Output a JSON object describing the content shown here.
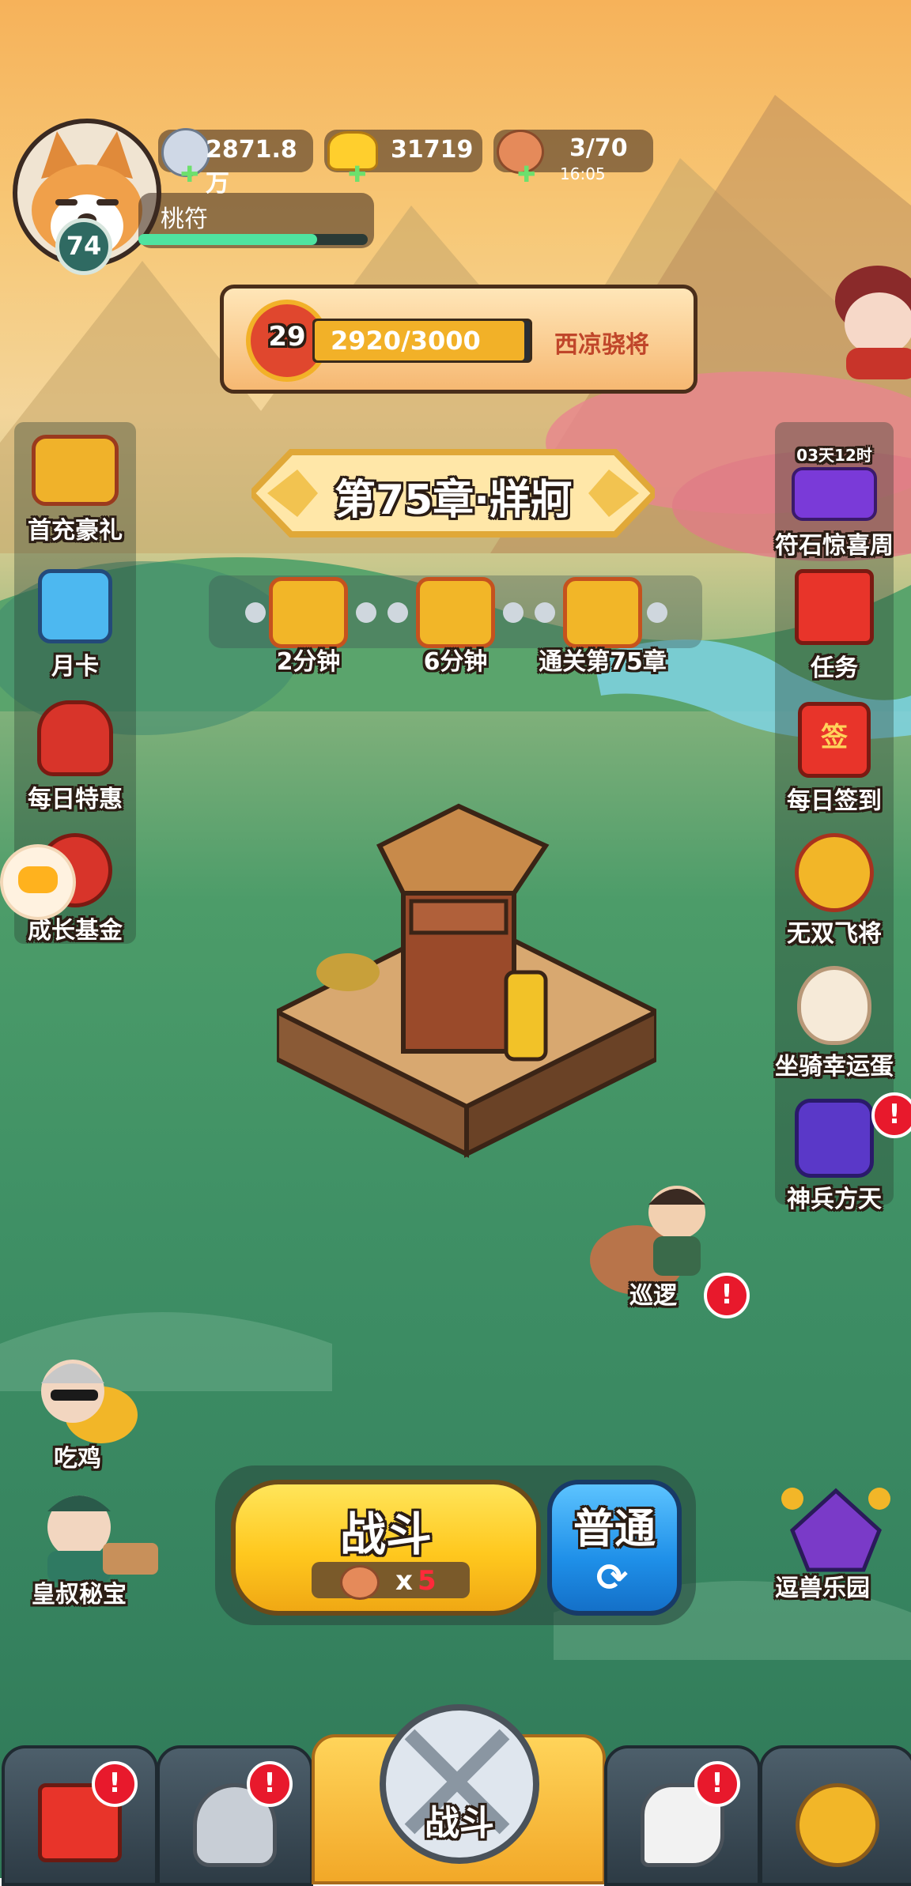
{
  "player": {
    "level": "74",
    "name": "桃符",
    "exp_fraction": 0.78
  },
  "resources": {
    "silver": "2871.8万",
    "gold": "31719",
    "stamina": "3/70",
    "stamina_timer": "16:05"
  },
  "rank": {
    "level": "29",
    "progress_text": "2920/3000",
    "progress_fraction": 0.973,
    "title": "西凉骁将"
  },
  "chapter": {
    "title": "第75章·牂牁"
  },
  "chests": [
    {
      "label": "2分钟"
    },
    {
      "label": "6分钟"
    },
    {
      "label": "通关第75章"
    }
  ],
  "left_menu": [
    {
      "label": "首充豪礼",
      "icon": "treasure-chest-icon"
    },
    {
      "label": "月卡",
      "icon": "month-card-icon"
    },
    {
      "label": "每日特惠",
      "icon": "gift-sack-icon"
    },
    {
      "label": "成长基金",
      "icon": "growth-fund-icon"
    }
  ],
  "right_menu": [
    {
      "label": "符石惊喜周",
      "icon": "rune-cards-icon",
      "timer": "03天12时"
    },
    {
      "label": "任务",
      "icon": "scroll-icon"
    },
    {
      "label": "每日签到",
      "icon": "sign-in-icon"
    },
    {
      "label": "无双飞将",
      "icon": "wheel-icon"
    },
    {
      "label": "坐骑幸运蛋",
      "icon": "egg-icon"
    },
    {
      "label": "神兵方天",
      "icon": "weapon-icon",
      "alert": "!"
    }
  ],
  "patrol": {
    "label": "巡逻",
    "alert": "!"
  },
  "bottom_left": [
    {
      "label": "吃鸡"
    },
    {
      "label": "皇叔秘宝"
    }
  ],
  "bottom_right": {
    "label": "逗兽乐园"
  },
  "battle": {
    "label": "战斗",
    "cost_prefix": "x",
    "cost": "5"
  },
  "mode": {
    "label": "普通"
  },
  "tabs": [
    {
      "name": "shop",
      "alert": "!"
    },
    {
      "name": "equipment",
      "alert": "!"
    },
    {
      "name": "battle",
      "label": "战斗"
    },
    {
      "name": "heroes",
      "alert": "!"
    },
    {
      "name": "upgrade"
    }
  ],
  "colors": {
    "accent": "#ffc81e",
    "alert": "#e8192c",
    "exp_bar": "#4fe3a0"
  }
}
